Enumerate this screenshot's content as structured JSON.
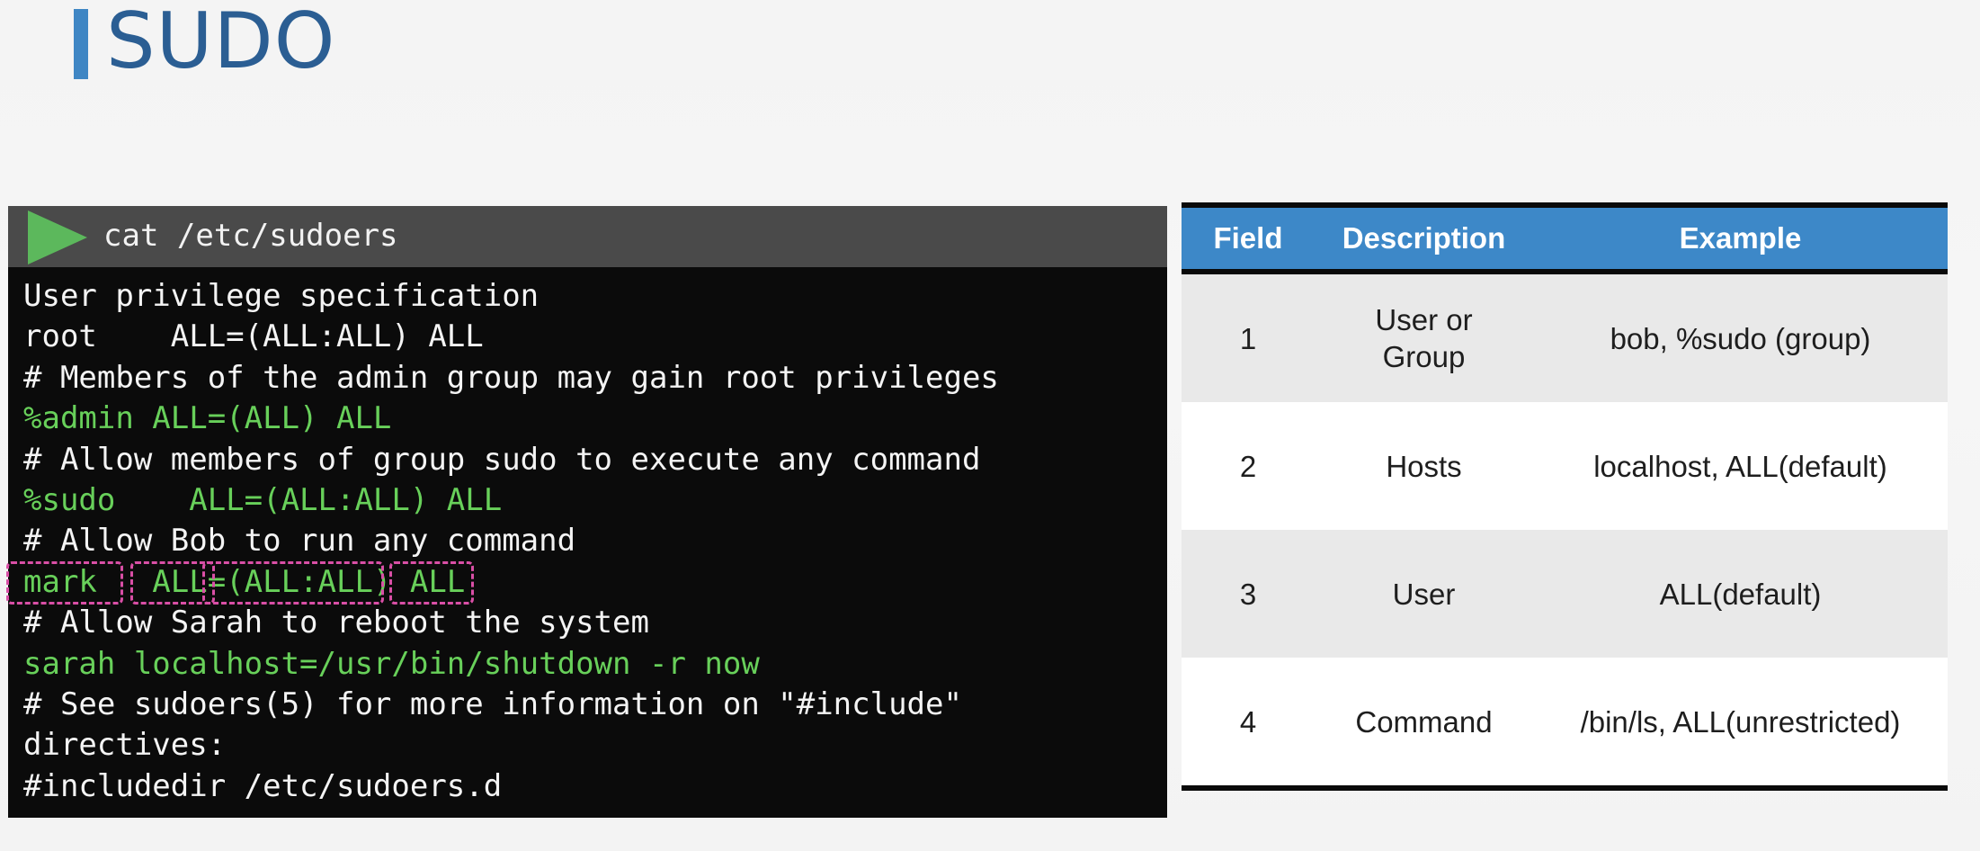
{
  "slide": {
    "title": "SUDO"
  },
  "terminal": {
    "command": "cat /etc/sudoers",
    "lines": [
      {
        "text": "User privilege specification",
        "color": "#f4f4f4"
      },
      {
        "text": "root    ALL=(ALL:ALL) ALL",
        "color": "#f4f4f4"
      },
      {
        "text": "# Members of the admin group may gain root privileges",
        "color": "#f4f4f4"
      },
      {
        "text": "%admin ALL=(ALL) ALL",
        "color": "#68d05a"
      },
      {
        "text": "# Allow members of group sudo to execute any command",
        "color": "#f4f4f4"
      },
      {
        "text": "%sudo    ALL=(ALL:ALL) ALL",
        "color": "#68d05a"
      },
      {
        "text": "# Allow Bob to run any command",
        "color": "#f4f4f4"
      },
      {
        "text": "mark   ALL=(ALL:ALL) ALL",
        "color": "#68d05a"
      },
      {
        "text": "# Allow Sarah to reboot the system",
        "color": "#f4f4f4"
      },
      {
        "text": "sarah localhost=/usr/bin/shutdown -r now",
        "color": "#68d05a"
      },
      {
        "text": "# See sudoers(5) for more information on \"#include\"",
        "color": "#f4f4f4"
      },
      {
        "text": "directives:",
        "color": "#f4f4f4"
      },
      {
        "text": "#includedir /etc/sudoers.d",
        "color": "#f4f4f4"
      }
    ]
  },
  "table": {
    "headers": [
      "Field",
      "Description",
      "Example"
    ],
    "rows": [
      {
        "field": "1",
        "description": "User or Group",
        "example": "bob, %sudo (group)"
      },
      {
        "field": "2",
        "description": "Hosts",
        "example": "localhost, ALL(default)"
      },
      {
        "field": "3",
        "description": "User",
        "example": "ALL(default)"
      },
      {
        "field": "4",
        "description": "Command",
        "example": "/bin/ls, ALL(unrestricted)"
      }
    ]
  },
  "colors": {
    "accent": "#3f86c4",
    "title": "#2b5e93",
    "terminal_green": "#68d05a",
    "highlight_dash": "#d94fa6"
  }
}
